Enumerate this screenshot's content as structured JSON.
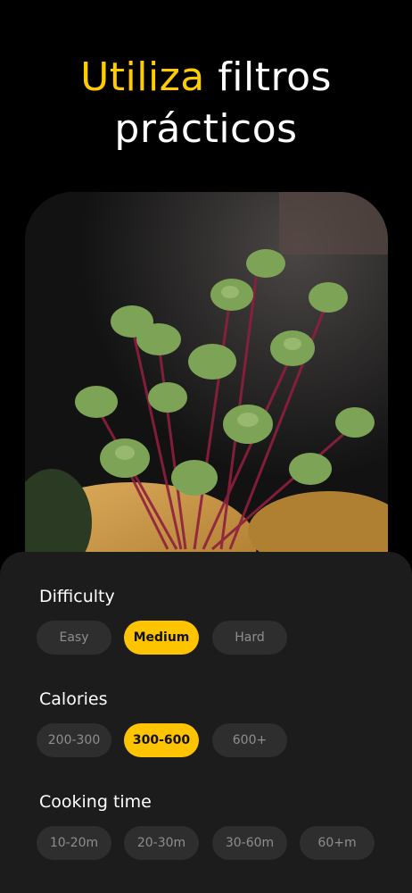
{
  "headline": {
    "accent": "Utiliza",
    "rest_line1": " filtros",
    "line2": "prácticos"
  },
  "colors": {
    "accent": "#ffcc00",
    "chip_selected": "#ffc400",
    "chip_default": "#2e2e2e",
    "panel": "#1c1c1c"
  },
  "filters": {
    "difficulty": {
      "title": "Difficulty",
      "options": [
        "Easy",
        "Medium",
        "Hard"
      ],
      "selected": "Medium"
    },
    "calories": {
      "title": "Calories",
      "options": [
        "200-300",
        "300-600",
        "600+"
      ],
      "selected": "300-600"
    },
    "cooking_time": {
      "title": "Cooking time",
      "options": [
        "10-20m",
        "20-30m",
        "30-60m",
        "60+m"
      ],
      "selected": ""
    }
  }
}
